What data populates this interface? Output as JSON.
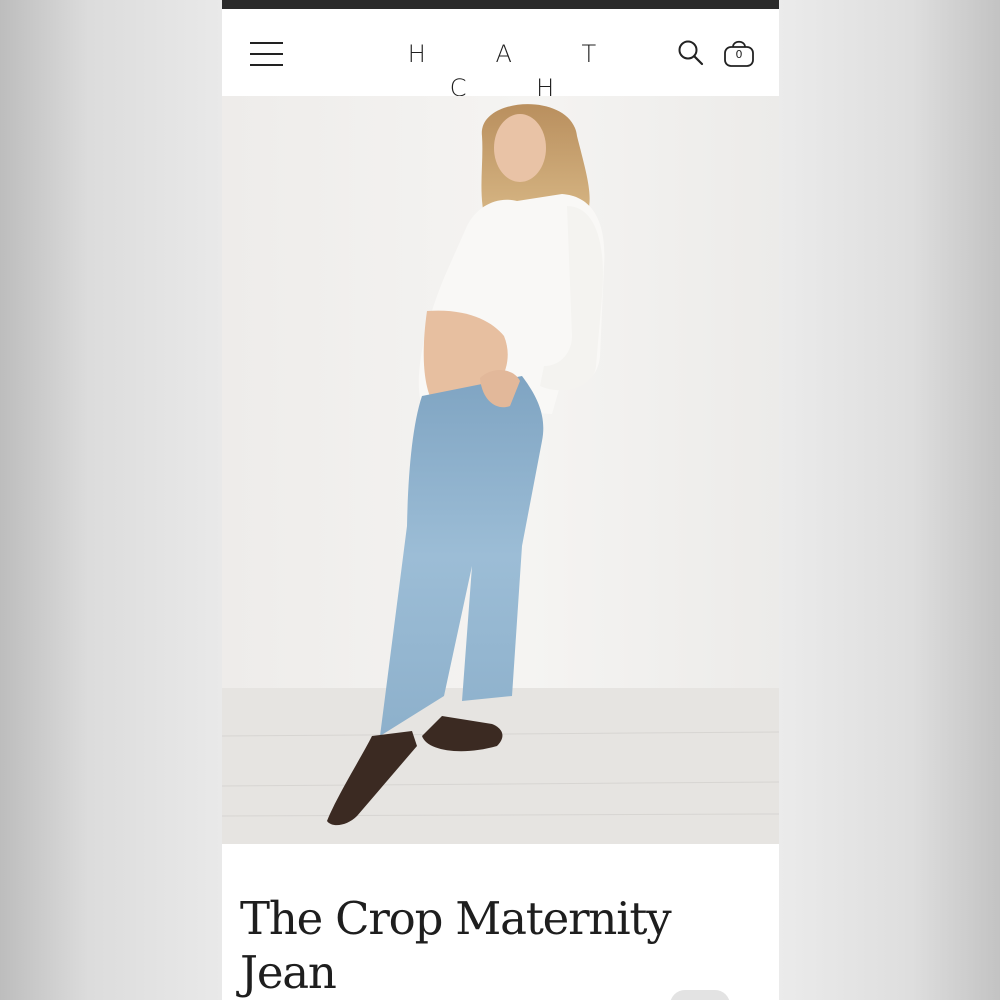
{
  "header": {
    "brand": "H A T C H",
    "cart_count": "0"
  },
  "icons": {
    "menu": "hamburger-menu-icon",
    "search": "search-icon",
    "cart": "shopping-basket-icon"
  },
  "hero": {
    "alt": "Model wearing a white knit cardigan, light-wash cropped maternity jeans and brown strappy sandals"
  },
  "product": {
    "title": "The Crop Maternity Jean"
  },
  "colors": {
    "status_bar": "#2b2b2b",
    "text": "#1e1e1e",
    "page_background": "#ffffff",
    "denim": "#8fb3cf"
  }
}
